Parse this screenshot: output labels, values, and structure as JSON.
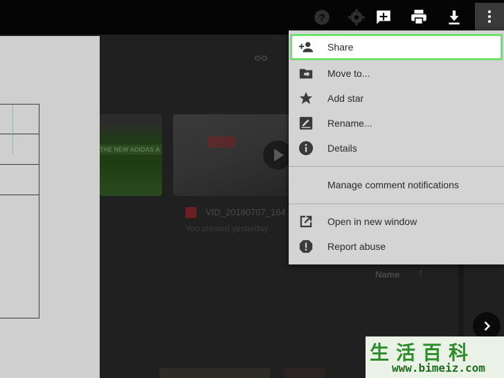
{
  "colors": {
    "menu_bg": "#d4d4d4",
    "highlight": "#6ee26e",
    "watermark_green": "#2e8b2e"
  },
  "toolbar": {
    "icons": [
      "help-icon",
      "settings-icon",
      "add-comment-icon",
      "print-icon",
      "download-icon",
      "more-vert-icon"
    ]
  },
  "file": {
    "name": "VID_20180707_164",
    "meta": "You created yesterday",
    "thumb_banner": "THE NEW ADIDAS A"
  },
  "list_header": {
    "name_label": "Name",
    "sort_arrow": "↑"
  },
  "menu": {
    "items": [
      {
        "label": "Share",
        "icon": "person-add-icon"
      },
      {
        "label": "Move to...",
        "icon": "folder-move-icon"
      },
      {
        "label": "Add star",
        "icon": "star-icon"
      },
      {
        "label": "Rename...",
        "icon": "edit-icon"
      },
      {
        "label": "Details",
        "icon": "info-icon"
      },
      {
        "label": "Manage comment notifications",
        "icon": ""
      },
      {
        "label": "Open in new window",
        "icon": "open-in-new-icon"
      },
      {
        "label": "Report abuse",
        "icon": "report-icon"
      }
    ]
  },
  "watermark": {
    "chinese": "生活百科",
    "url": "www.bimeiz.com"
  }
}
